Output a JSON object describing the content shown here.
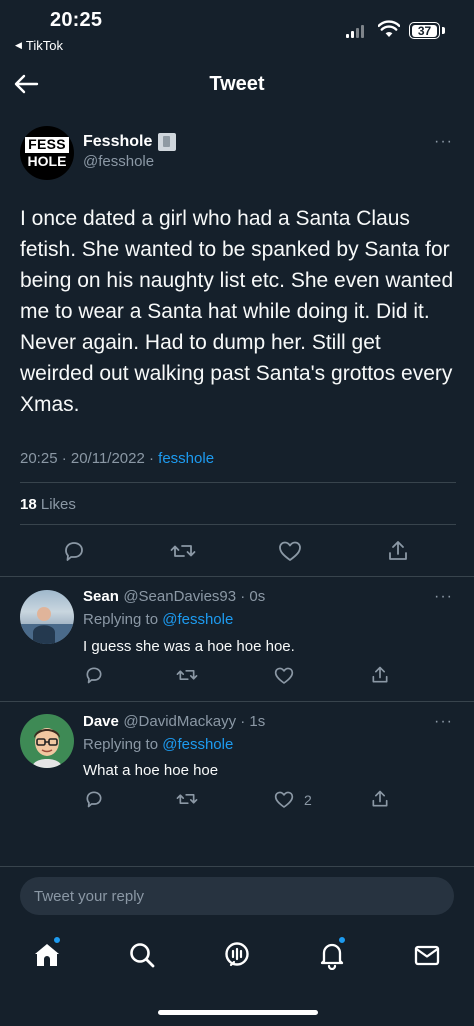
{
  "status_bar": {
    "time": "20:25",
    "back_app": "TikTok",
    "battery": "37"
  },
  "header": {
    "title": "Tweet"
  },
  "tweet": {
    "author_name": "Fesshole",
    "author_handle": "@fesshole",
    "avatar_line1": "FESS",
    "avatar_line2": "HOLE",
    "text": "I once dated a girl who had a Santa Claus fetish. She wanted to be spanked by Santa for being on his naughty list etc. She even wanted me to wear a Santa hat while doing it. Did it. Never again. Had to dump her. Still get weirded out walking past Santa's grottos every Xmas.",
    "timestamp": "20:25 · 20/11/2022 · ",
    "source": "fesshole",
    "likes_count": "18",
    "likes_label": "Likes"
  },
  "replies": [
    {
      "name": "Sean",
      "handle_time": "@SeanDavies93 · 0s",
      "replying_prefix": "Replying to ",
      "replying_to": "@fesshole",
      "text": "I guess she was a hoe hoe hoe.",
      "like_count": ""
    },
    {
      "name": "Dave",
      "handle_time": "@DavidMackayy · 1s",
      "replying_prefix": "Replying to ",
      "replying_to": "@fesshole",
      "text": "What a hoe hoe hoe",
      "like_count": "2"
    }
  ],
  "composer": {
    "placeholder": "Tweet your reply"
  },
  "more_glyph": "···",
  "colors": {
    "background": "#15202b",
    "accent": "#1d9bf0",
    "muted": "#8b98a5",
    "divider": "#38444d"
  },
  "icons": [
    "arrow-left-icon",
    "comment-icon",
    "retweet-icon",
    "heart-icon",
    "share-icon",
    "home-icon",
    "search-icon",
    "spaces-icon",
    "bell-icon",
    "mail-icon"
  ]
}
